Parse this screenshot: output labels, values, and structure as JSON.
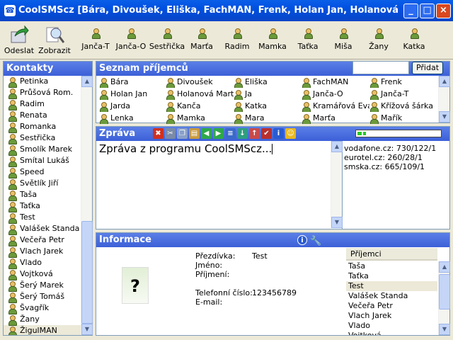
{
  "window": {
    "title": "CoolSMScz [Bára, Divoušek, Eliška, FachMAN, Frenk, Holan Jan, Holanová Marta, Ja, ..."
  },
  "toolbar": {
    "send_label": "Odeslat",
    "show_label": "Zobrazit",
    "quick_contacts": [
      "Janča-T",
      "Janča-O",
      "Sestřička",
      "Marťa",
      "Radim",
      "Mamka",
      "Taťka",
      "Miša",
      "Žany",
      "Katka"
    ]
  },
  "contacts": {
    "title": "Kontakty",
    "items": [
      "Petinka",
      "Průšová Rom.",
      "Radim",
      "Renata",
      "Romanka",
      "Sestřička",
      "Smolík Marek",
      "Smítal Lukáš",
      "Speed",
      "Světlík Jiří",
      "Taša",
      "Taťka",
      "Test",
      "Valášek Standa",
      "Večeřa Petr",
      "Vlach Jarek",
      "Vlado",
      "Vojtková",
      "Šerý Marek",
      "Šerý Tomáš",
      "Švagřík",
      "Žany",
      "ŽigulMAN"
    ],
    "selected": "ŽigulMAN"
  },
  "recipients": {
    "title": "Seznam příjemců",
    "search_value": "",
    "add_label": "Přidat",
    "items": [
      "Bára",
      "Divoušek",
      "Eliška",
      "FachMAN",
      "Frenk",
      "Holan Jan",
      "Holanová Marta",
      "Ja",
      "Janča-O",
      "Janča-T",
      "Jarda",
      "Kanča",
      "Katka",
      "Kramářová Eva",
      "Křížová šárka",
      "Lenka",
      "Mamka",
      "Mara",
      "Marťa",
      "Mařík"
    ]
  },
  "message": {
    "title": "Zpráva",
    "text": "Zpráva z programu CoolSMScz...",
    "credit_fraction": 0.1,
    "servers": [
      "vodafone.cz: 730/122/1",
      "eurotel.cz: 260/28/1",
      "smska.cz: 665/109/1"
    ],
    "toolbar_icons": [
      "delete-icon",
      "cut-icon",
      "copy-icon",
      "paste-icon",
      "back-icon",
      "forward-icon",
      "template-icon",
      "import-icon",
      "export-icon",
      "spellcheck-icon",
      "info-icon",
      "smiley-icon"
    ]
  },
  "info": {
    "title": "Informace",
    "photo_placeholder": "?",
    "labels": {
      "nick": "Přezdívka:",
      "first": "Jméno:",
      "last": "Příjmení:",
      "phone": "Telefonní číslo:",
      "email": "E-mail:"
    },
    "values": {
      "nick": "Test",
      "first": "",
      "last": "",
      "phone": "123456789",
      "email": ""
    },
    "recipients_header": "Příjemci",
    "recipients": [
      "Taša",
      "Taťka",
      "Test",
      "Valášek Standa",
      "Večeřa Petr",
      "Vlach Jarek",
      "Vlado",
      "Vojtková"
    ],
    "recipients_selected": "Test"
  },
  "colors": {
    "accent": "#3C60D8",
    "titlebar": "#0A5FE8",
    "close": "#D9481F"
  }
}
